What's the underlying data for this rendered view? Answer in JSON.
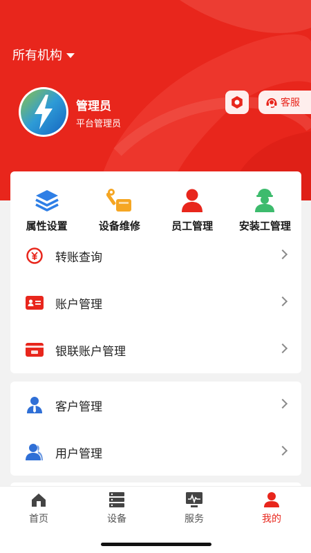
{
  "header": {
    "org_selector": "所有机构",
    "user_name": "管理员",
    "user_role": "平台管理员",
    "service_label": "客服",
    "accent_color": "#e8261c"
  },
  "quick_actions": [
    {
      "label": "属性设置",
      "icon": "layers-icon"
    },
    {
      "label": "设备维修",
      "icon": "wrench-icon"
    },
    {
      "label": "员工管理",
      "icon": "person-icon"
    },
    {
      "label": "安装工管理",
      "icon": "worker-icon"
    }
  ],
  "menu_group_1": [
    {
      "label": "转账查询",
      "icon": "transfer-yuan-icon"
    },
    {
      "label": "账户管理",
      "icon": "id-card-icon"
    },
    {
      "label": "银联账户管理",
      "icon": "unionpay-card-icon"
    }
  ],
  "menu_group_2": [
    {
      "label": "客户管理",
      "icon": "customer-icon"
    },
    {
      "label": "用户管理",
      "icon": "users-icon"
    }
  ],
  "tabbar": [
    {
      "label": "首页",
      "icon": "home-icon",
      "active": false
    },
    {
      "label": "设备",
      "icon": "server-icon",
      "active": false
    },
    {
      "label": "服务",
      "icon": "monitor-icon",
      "active": false
    },
    {
      "label": "我的",
      "icon": "profile-icon",
      "active": true
    }
  ]
}
